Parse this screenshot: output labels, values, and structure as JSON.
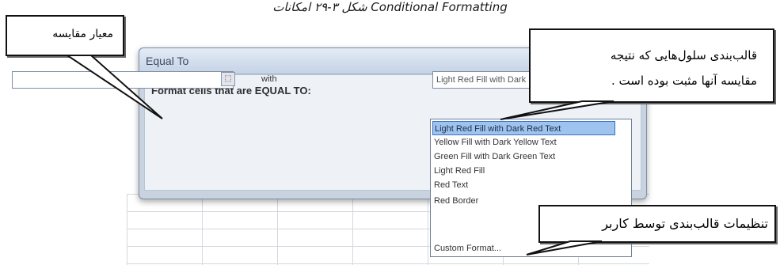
{
  "caption": "شکل ۳-۲۹ امکانات Conditional Formatting",
  "dialog": {
    "title": "Equal To",
    "heading": "Format cells that are EQUAL TO:",
    "with_label": "with",
    "selected_format": "Light Red Fill with Dark Red Text",
    "options": [
      "Light Red Fill with Dark Red Text",
      "Yellow Fill with Dark Yellow Text",
      "Green Fill with Dark Green Text",
      "Light Red Fill",
      "Red Text",
      "Red Border",
      "Custom Format..."
    ]
  },
  "callouts": {
    "comparison_criterion": "معیار مقایسه",
    "result_format_line1": "قالب‌بندی سلول‌هایی که نتیجه",
    "result_format_line2": "مقایسه آنها مثبت بوده است .",
    "user_format_settings": "تنظیمات قالب‌بندی توسط کاربر"
  },
  "colors": {
    "selected_option_bg": "#9ec3ef",
    "dialog_bg": "#c9d3df"
  }
}
